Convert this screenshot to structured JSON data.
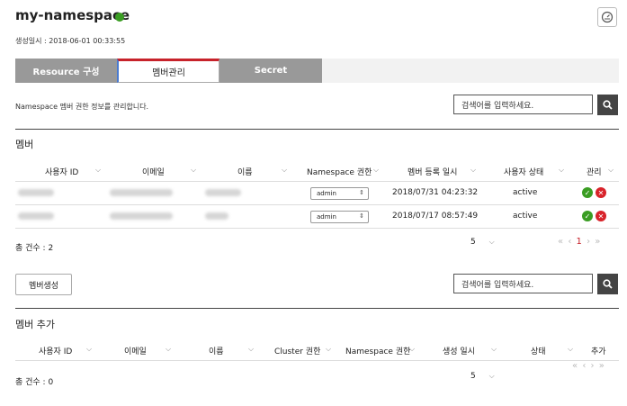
{
  "header": {
    "title": "my-namespace",
    "created": "생성일시 : 2018-06-01 00:33:55",
    "status_color": "#3a9d23",
    "top_icon": "dashboard-icon"
  },
  "tabs": [
    {
      "label": "Resource 구성",
      "active": false
    },
    {
      "label": "멤버관리",
      "active": true
    },
    {
      "label": "Secret",
      "active": false
    }
  ],
  "description": "Namespace 멤버 권한 정보를 관리합니다.",
  "search": {
    "placeholder": "검색어를 입력하세요.",
    "icon": "search-icon"
  },
  "members": {
    "title": "멤버",
    "columns": [
      "사용자 ID",
      "이메일",
      "이름",
      "Namespace 권한",
      "멤버 등록 일시",
      "사용자 상태",
      "관리"
    ],
    "rows": [
      {
        "role": "admin",
        "registered": "2018/07/31 04:23:32",
        "status": "active"
      },
      {
        "role": "admin",
        "registered": "2018/07/17 08:57:49",
        "status": "active"
      }
    ],
    "total": "총 건수 : 2",
    "page_size": "5",
    "current_page": "1"
  },
  "create_button": "멤버생성",
  "add_members": {
    "title": "멤버 추가",
    "columns": [
      "사용자 ID",
      "이메일",
      "이름",
      "Cluster 권한",
      "Namespace 권한",
      "생성 일시",
      "상태",
      "추가"
    ],
    "total": "총 건수 : 0",
    "page_size": "5"
  },
  "colors": {
    "accent_red": "#c7222a",
    "ok_green": "#3a9d23",
    "delete_red": "#d8232a",
    "tab_gray": "#999999"
  }
}
